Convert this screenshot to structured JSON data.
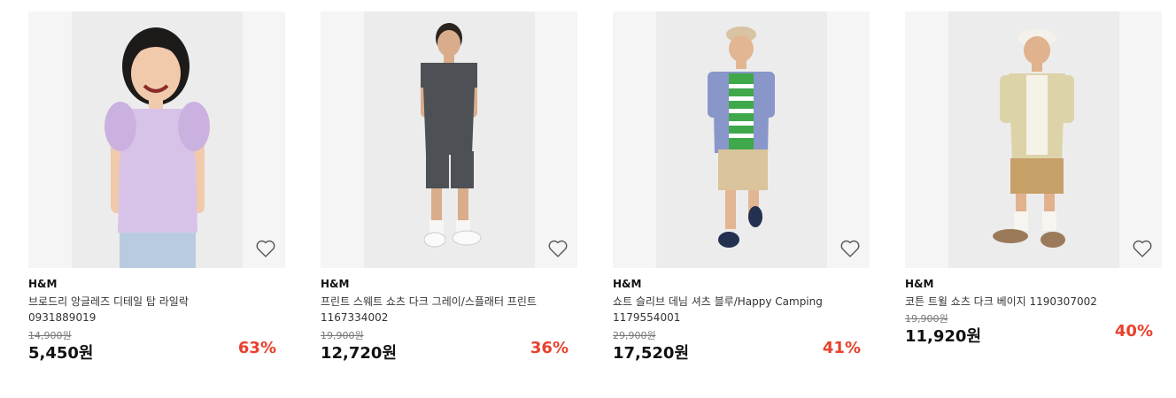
{
  "products": [
    {
      "brand": "H&M",
      "name": "브로드리 앙글레즈 디테일 탑 라일락",
      "code": "0931889019",
      "original_price": "14,900원",
      "price": "5,450원",
      "discount": "63%"
    },
    {
      "brand": "H&M",
      "name": "프린트 스웨트 쇼츠 다크 그레이/스플래터 프린트",
      "code": "1167334002",
      "original_price": "19,900원",
      "price": "12,720원",
      "discount": "36%"
    },
    {
      "brand": "H&M",
      "name": "쇼트 슬리브 데님 셔츠 블루/Happy Camping",
      "code": "1179554001",
      "original_price": "29,900원",
      "price": "17,520원",
      "discount": "41%"
    },
    {
      "brand": "H&M",
      "name": "코튼 트윌 쇼츠 다크 베이지 1190307002",
      "code": "",
      "original_price": "19,900원",
      "price": "11,920원",
      "discount": "40%"
    }
  ],
  "icons": {
    "wishlist": "heart-outline-icon"
  },
  "colors": {
    "discount": "#e8412c",
    "text": "#111111",
    "muted": "#777777"
  }
}
